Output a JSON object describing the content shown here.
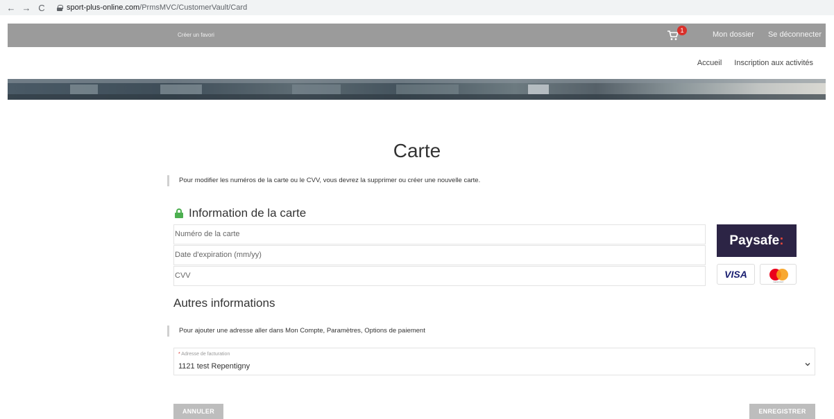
{
  "browser": {
    "back": "←",
    "forward": "→",
    "reload": "C",
    "url_host": "sport-plus-online.com",
    "url_path": "/PrmsMVC/CustomerVault/Card"
  },
  "topbar": {
    "favorite_link": "Créer un favori",
    "cart_count": "1",
    "my_file": "Mon dossier",
    "logout": "Se déconnecter"
  },
  "subnav": {
    "home": "Accueil",
    "registration": "Inscription aux activités"
  },
  "page": {
    "title": "Carte",
    "note_card": "Pour modifier les numéros de la carte ou le CVV, vous devrez la supprimer ou créer une nouvelle carte.",
    "card_section_title": "Information de la carte",
    "card_number_placeholder": "Numéro de la carte",
    "expiry_placeholder": "Date d'expiration (mm/yy)",
    "cvv_placeholder": "CVV",
    "other_section_title": "Autres informations",
    "note_address": "Pour ajouter une adresse aller dans Mon Compte, Paramètres, Options de paiement",
    "billing_required_mark": "*",
    "billing_label": "Adresse de facturation",
    "billing_value": "1121 test Repentigny",
    "cancel_button": "ANNULER",
    "save_button": "ENREGISTRER"
  },
  "brands": {
    "paysafe_text": "Paysafe",
    "paysafe_colon": ":",
    "visa_text": "VISA",
    "mastercard_text": "mastercard"
  },
  "colors": {
    "topbar": "#9b9b9b",
    "badge": "#d9302a",
    "lock": "#4caf50",
    "paysafe_bg": "#2c2445",
    "button": "#bdbdbd"
  }
}
